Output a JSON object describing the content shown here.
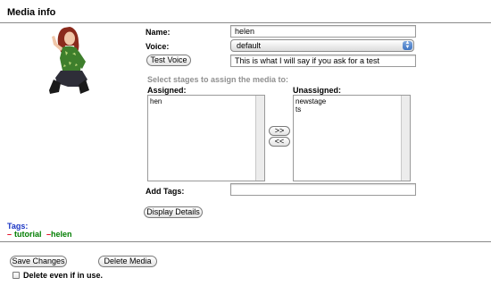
{
  "section": {
    "title": "Media info"
  },
  "form": {
    "name_label": "Name:",
    "name_value": "helen",
    "voice_label": "Voice:",
    "voice_selected": "default",
    "test_voice_button": "Test Voice",
    "test_text_value": "This is what I will say if you ask for a test",
    "stages_hint": "Select stages to assign the media to:",
    "assigned_label": "Assigned:",
    "unassigned_label": "Unassigned:",
    "assigned_items": [
      "hen"
    ],
    "unassigned_items": [
      "newstage",
      "ts"
    ],
    "move_right_button": ">>",
    "move_left_button": "<<",
    "add_tags_label": "Add Tags:",
    "add_tags_value": "",
    "display_details_button": "Display Details"
  },
  "tags": {
    "title": "Tags:",
    "items": [
      {
        "remove": "–",
        "name": "tutorial"
      },
      {
        "remove": "–",
        "name": "helen"
      }
    ]
  },
  "actions": {
    "save_button": "Save Changes",
    "delete_button": "Delete Media",
    "delete_checkbox_label": "Delete even if in use."
  },
  "colors": {
    "tag_remove": "#e0001b",
    "tag_name": "#007d00",
    "tags_title": "#1a35c4",
    "hint": "#909090"
  }
}
